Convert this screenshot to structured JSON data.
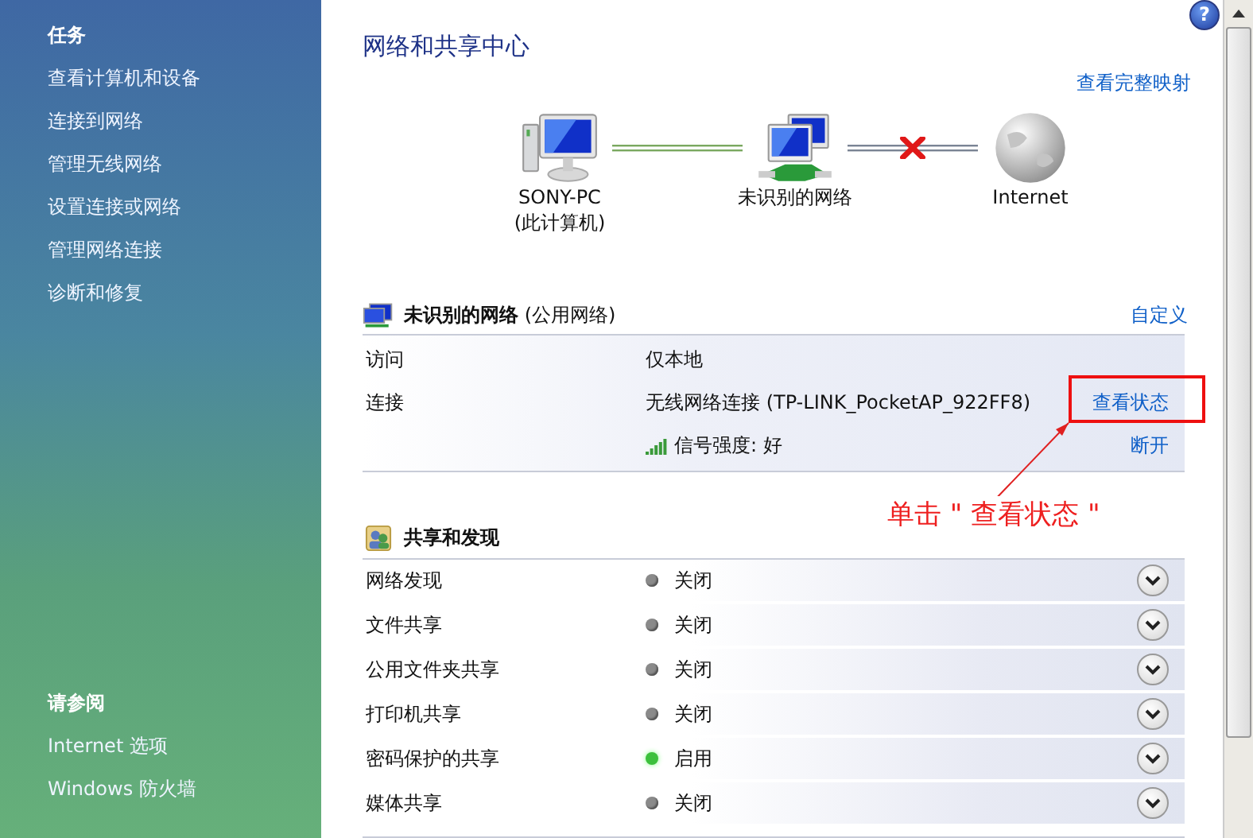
{
  "sidebar": {
    "tasks_heading": "任务",
    "tasks": [
      "查看计算机和设备",
      "连接到网络",
      "管理无线网络",
      "设置连接或网络",
      "管理网络连接",
      "诊断和修复"
    ],
    "see_also_heading": "请参阅",
    "see_also": [
      "Internet 选项",
      "Windows 防火墙"
    ]
  },
  "help_button": "?",
  "main": {
    "title": "网络和共享中心",
    "full_map_link": "查看完整映射",
    "map": {
      "nodes": [
        {
          "kind": "computer",
          "label": "SONY-PC",
          "sublabel": "(此计算机)"
        },
        {
          "kind": "network",
          "label": "未识别的网络"
        },
        {
          "kind": "internet",
          "label": "Internet"
        }
      ],
      "links": [
        {
          "connected": true
        },
        {
          "connected": false
        }
      ]
    },
    "network": {
      "name": "未识别的网络",
      "type": "(公用网络)",
      "customize_link": "自定义",
      "rows": [
        {
          "kind": "text",
          "label": "访问",
          "value": "仅本地"
        },
        {
          "kind": "text",
          "label": "连接",
          "value": "无线网络连接 (TP-LINK_PocketAP_922FF8)",
          "link": "查看状态"
        },
        {
          "kind": "signal",
          "value": "信号强度: 好",
          "link": "断开"
        }
      ]
    },
    "sharing": {
      "heading": "共享和发现",
      "items": [
        {
          "label": "网络发现",
          "status": "关闭",
          "on": false
        },
        {
          "label": "文件共享",
          "status": "关闭",
          "on": false
        },
        {
          "label": "公用文件夹共享",
          "status": "关闭",
          "on": false
        },
        {
          "label": "打印机共享",
          "status": "关闭",
          "on": false
        },
        {
          "label": "密码保护的共享",
          "status": "启用",
          "on": true
        },
        {
          "label": "媒体共享",
          "status": "关闭",
          "on": false
        }
      ]
    }
  },
  "annotation": {
    "text": "单击 \" 查看状态 \""
  }
}
